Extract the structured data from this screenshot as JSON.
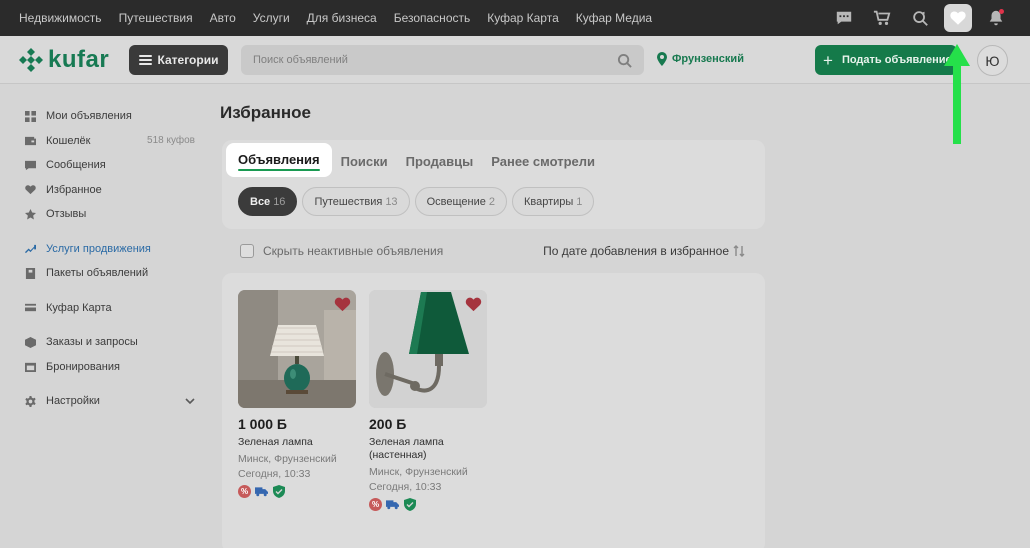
{
  "topnav": [
    "Недвижимость",
    "Путешествия",
    "Авто",
    "Услуги",
    "Для бизнеса",
    "Безопасность",
    "Куфар Карта",
    "Куфар Медиа"
  ],
  "top_icons": [
    "chat-icon",
    "cart-icon",
    "search-refresh-icon",
    "heart-icon",
    "bell-icon"
  ],
  "header": {
    "logo": "kufar",
    "categories_label": "Категории",
    "search_placeholder": "Поиск объявлений",
    "location": "Фрунзенский",
    "post_label": "Подать объявление",
    "avatar": "Ю"
  },
  "sidebar": {
    "items": [
      {
        "label": "Мои объявления",
        "icon": "grid-icon"
      },
      {
        "label": "Кошелёк",
        "icon": "wallet-icon",
        "extra": "518 куфов"
      },
      {
        "label": "Сообщения",
        "icon": "message-icon"
      },
      {
        "label": "Избранное",
        "icon": "heart-icon"
      },
      {
        "label": "Отзывы",
        "icon": "star-icon"
      },
      {
        "label": "Услуги продвижения",
        "icon": "trend-icon"
      },
      {
        "label": "Пакеты объявлений",
        "icon": "package-icon"
      },
      {
        "label": "Куфар Карта",
        "icon": "card-icon"
      },
      {
        "label": "Заказы и запросы",
        "icon": "box-icon"
      },
      {
        "label": "Бронирования",
        "icon": "calendar-icon"
      },
      {
        "label": "Настройки",
        "icon": "gear-icon"
      }
    ]
  },
  "main": {
    "title": "Избранное",
    "tabs": [
      "Объявления",
      "Поиски",
      "Продавцы",
      "Ранее смотрели"
    ],
    "chips": [
      {
        "label": "Все",
        "count": "16"
      },
      {
        "label": "Путешествия",
        "count": "13"
      },
      {
        "label": "Освещение",
        "count": "2"
      },
      {
        "label": "Квартиры",
        "count": "1"
      }
    ],
    "hide_inactive_label": "Скрыть неактивные объявления",
    "sort_label": "По дате добавления в избранное"
  },
  "ads": [
    {
      "price": "1 000 Б",
      "title": "Зеленая лампа",
      "location": "Минск, Фрунзенский",
      "time": "Сегодня, 10:33"
    },
    {
      "price": "200 Б",
      "title": "Зеленая лампа (настенная)",
      "location": "Минск, Фрунзенский",
      "time": "Сегодня, 10:33"
    }
  ],
  "colors": {
    "brand": "#177a53",
    "accent_green": "#1a9a52",
    "arrow": "#25e04a"
  }
}
